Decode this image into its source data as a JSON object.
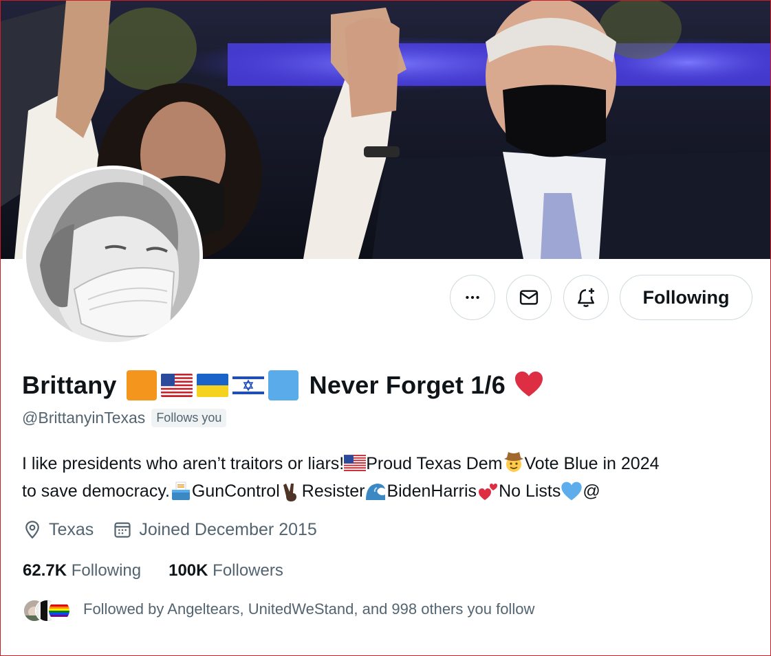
{
  "profile": {
    "display_name": "Brittany",
    "name_suffix": "Never Forget 1/6",
    "handle": "@BrittanyinTexas",
    "follows_you_badge": "Follows you",
    "colors": {
      "orange_square": "#f4951d",
      "blue_square": "#5aabea",
      "heart": "#dd2e44"
    }
  },
  "actions": {
    "more_icon": "more-horizontal-icon",
    "message_icon": "envelope-icon",
    "notify_icon": "bell-plus-icon",
    "follow_label": "Following"
  },
  "bio": {
    "part1": "I like presidents who aren’t traitors or liars!",
    "part2": "Proud Texas Dem",
    "part3": "Vote Blue in 2024",
    "part4": "to save democracy.",
    "part5": "GunControl",
    "part6": "Resister",
    "part7": "BidenHarris",
    "part8": "No Lists",
    "part9": "@"
  },
  "meta": {
    "location": "Texas",
    "joined": "Joined December 2015"
  },
  "stats": {
    "following_count": "62.7K",
    "following_label": "Following",
    "followers_count": "100K",
    "followers_label": "Followers"
  },
  "followed_by": {
    "text": "Followed by Angeltears, UnitedWeStand, and 998 others you follow"
  }
}
